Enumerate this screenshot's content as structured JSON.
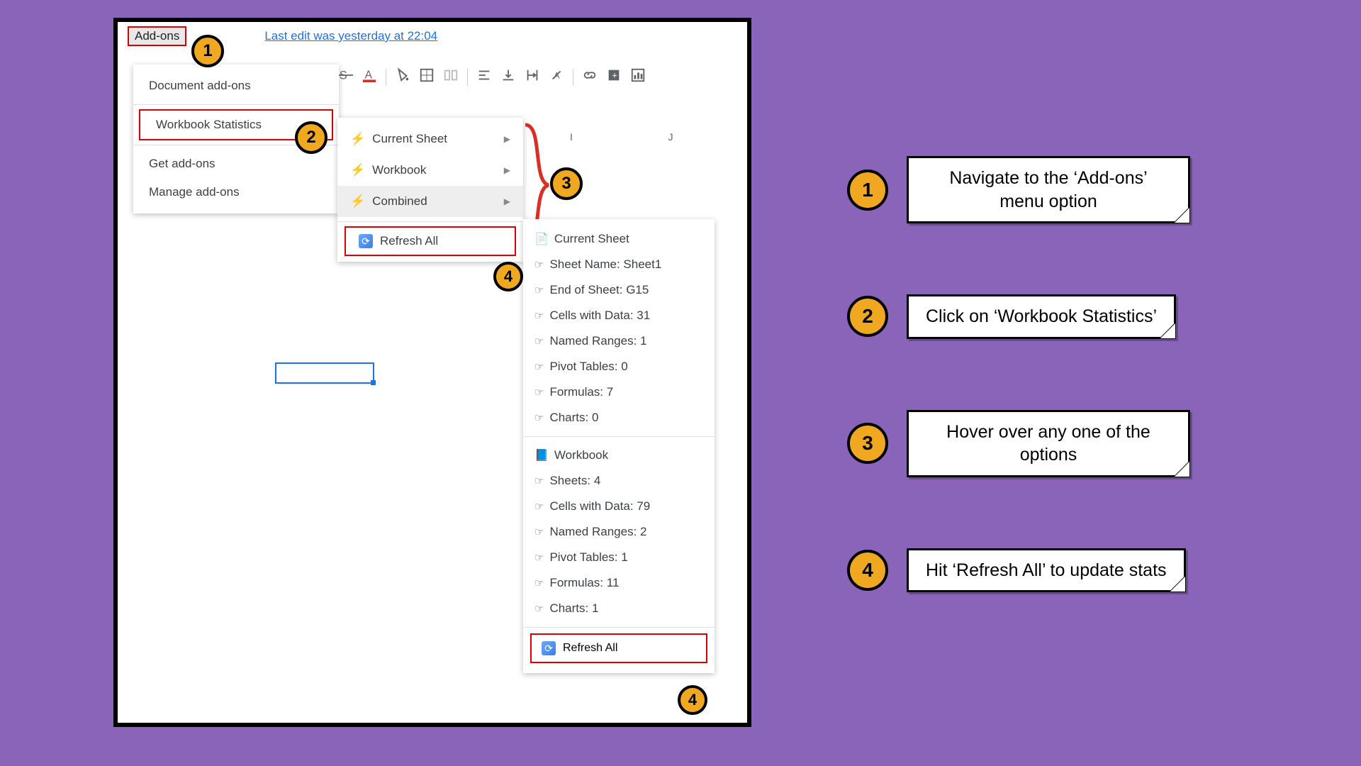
{
  "topbar": {
    "addons_label": "Add-ons",
    "edit_status": "Last edit was yesterday at 22:04"
  },
  "columns": {
    "i": "I",
    "j": "J"
  },
  "dropdown1": {
    "document_addons": "Document add-ons",
    "workbook_statistics": "Workbook Statistics",
    "get": "Get add-ons",
    "manage": "Manage add-ons"
  },
  "dropdown2": {
    "current_sheet": "Current Sheet",
    "workbook": "Workbook",
    "combined": "Combined",
    "refresh_all": "Refresh All"
  },
  "submenu": {
    "cs_header": "Current Sheet",
    "cs_items": [
      "Sheet Name: Sheet1",
      "End of Sheet: G15",
      "Cells with Data: 31",
      "Named Ranges: 1",
      "Pivot Tables: 0",
      "Formulas: 7",
      "Charts: 0"
    ],
    "wb_header": "Workbook",
    "wb_items": [
      "Sheets: 4",
      "Cells with Data: 79",
      "Named Ranges: 2",
      "Pivot Tables: 1",
      "Formulas: 11",
      "Charts: 1"
    ],
    "refresh_all": "Refresh All"
  },
  "callouts": {
    "n1": "1",
    "n2": "2",
    "n3": "3",
    "n4": "4"
  },
  "legend": {
    "t1": "Navigate to the ‘Add-ons’ menu option",
    "t2": "Click on ‘Workbook Statistics’",
    "t3": "Hover over any one of the options",
    "t4": "Hit ‘Refresh All’ to update stats"
  }
}
